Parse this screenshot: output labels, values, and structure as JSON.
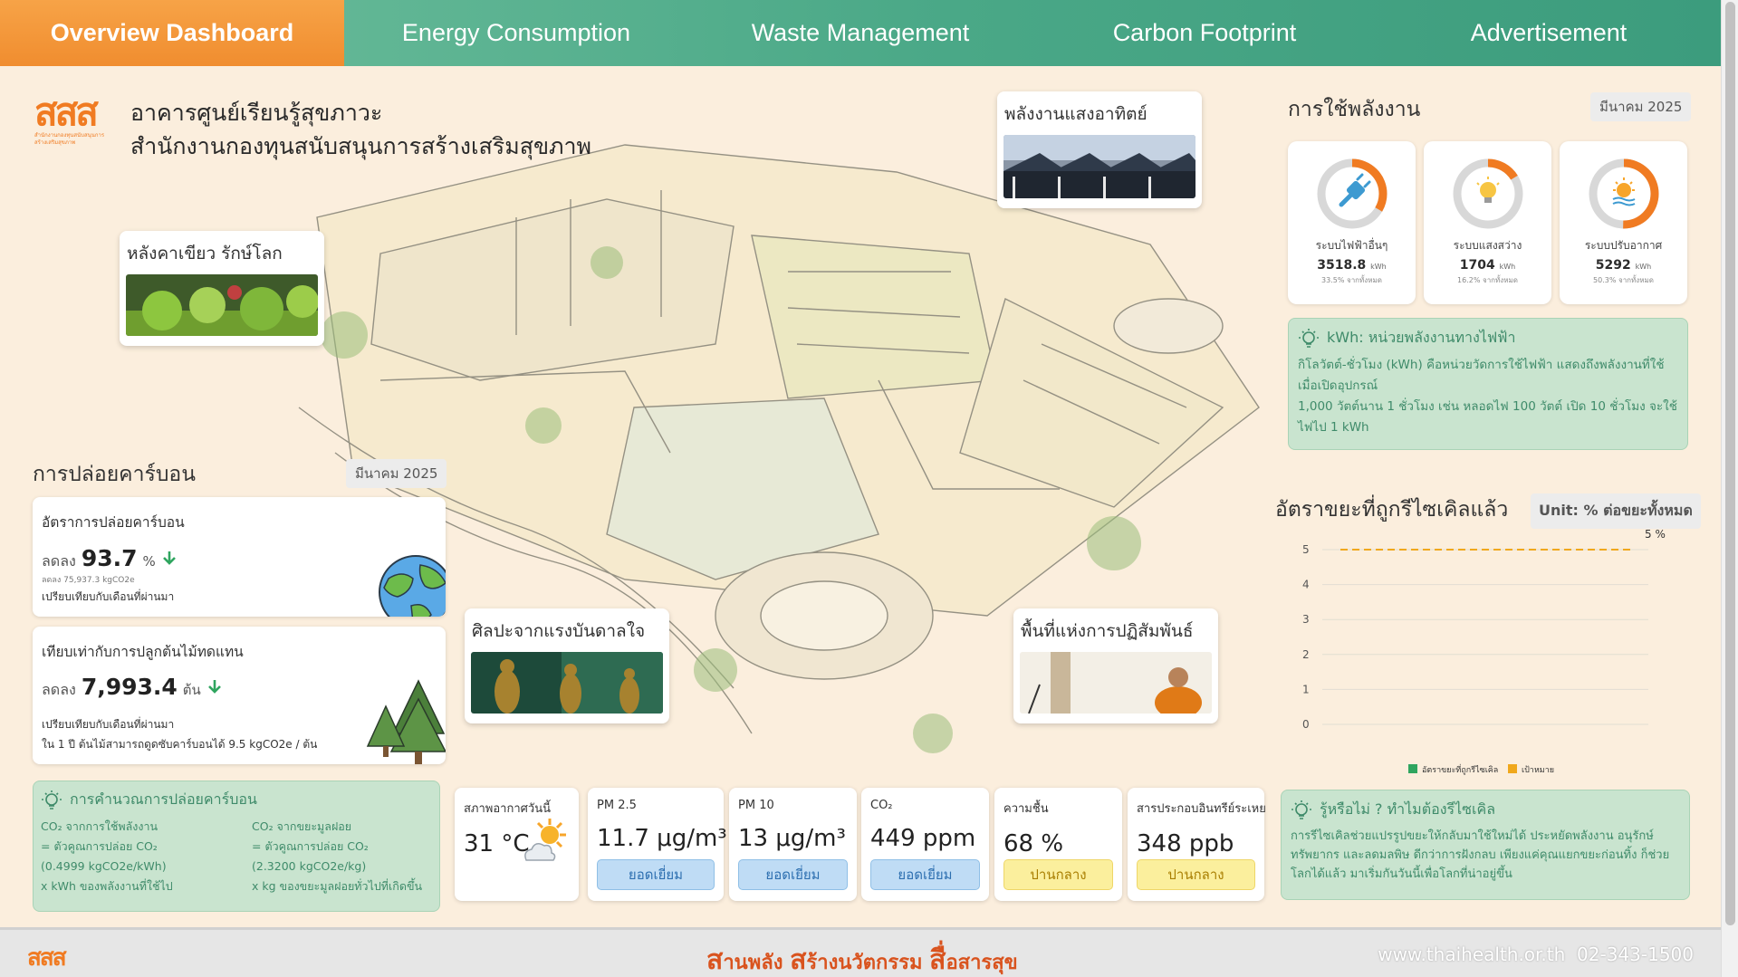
{
  "nav": {
    "tabs": [
      {
        "label": "Overview Dashboard",
        "active": true
      },
      {
        "label": "Energy Consumption",
        "active": false
      },
      {
        "label": "Waste Management",
        "active": false
      },
      {
        "label": "Carbon Footprint",
        "active": false
      },
      {
        "label": "Advertisement",
        "active": false
      }
    ]
  },
  "header": {
    "logo_text": "สสส",
    "logo_caption": "สำนักงานกองทุนสนับสนุนการสร้างเสริมสุขภาพ",
    "title_line1": "อาคารศูนย์เรียนรู้สุขภาวะ",
    "title_line2": "สำนักงานกองทุนสนับสนุนการสร้างเสริมสุขภาพ"
  },
  "photo_cards": {
    "green_roof": "หลังคาเขียว รักษ์โลก",
    "solar": "พลังงานแสงอาทิตย์",
    "art": "ศิลปะจากแรงบันดาลใจ",
    "interaction": "พื้นที่แห่งการปฏิสัมพันธ์"
  },
  "energy": {
    "title": "การใช้พลังงาน",
    "period": "มีนาคม 2025",
    "gauges": [
      {
        "label": "ระบบไฟฟ้าอื่นๆ",
        "value": "3518.8",
        "unit": "kWh",
        "share": "33.5% จากทั้งหมด",
        "fraction": 0.335,
        "icon": "plug-icon"
      },
      {
        "label": "ระบบแสงสว่าง",
        "value": "1704",
        "unit": "kWh",
        "share": "16.2% จากทั้งหมด",
        "fraction": 0.162,
        "icon": "bulb-icon"
      },
      {
        "label": "ระบบปรับอากาศ",
        "value": "5292",
        "unit": "kWh",
        "share": "50.3% จากทั้งหมด",
        "fraction": 0.503,
        "icon": "ac-icon"
      }
    ],
    "info_title": "kWh: หน่วยพลังงานทางไฟฟ้า",
    "info_line1": "กิโลวัตต์-ชั่วโมง (kWh) คือหน่วยวัดการใช้ไฟฟ้า แสดงถึงพลังงานที่ใช้เมื่อเปิดอุปกรณ์",
    "info_line2": "1,000 วัตต์นาน 1 ชั่วโมง เช่น หลอดไฟ 100 วัตต์ เปิด 10 ชั่วโมง จะใช้ไฟไป 1 kWh"
  },
  "carbon": {
    "title": "การปล่อยคาร์บอน",
    "period": "มีนาคม 2025",
    "rate_title": "อัตราการปล่อยคาร์บอน",
    "rate_prefix": "ลดลง",
    "rate_value": "93.7",
    "rate_unit": "%",
    "rate_detail": "ลดลง 75,937.3 kgCO2e",
    "rate_compare": "เปรียบเทียบกับเดือนที่ผ่านมา",
    "tree_title": "เทียบเท่ากับการปลูกต้นไม้ทดแทน",
    "tree_prefix": "ลดลง",
    "tree_value": "7,993.4",
    "tree_unit": "ต้น",
    "tree_compare": "เปรียบเทียบกับเดือนที่ผ่านมา",
    "tree_note": "ใน 1 ปี ต้นไม้สามารถดูดซับคาร์บอนได้ 9.5 kgCO2e / ต้น",
    "calc_title": "การคำนวณการปล่อยคาร์บอน",
    "calc_left": [
      "CO₂ จากการใช้พลังงาน",
      "= ตัวคูณการปล่อย CO₂",
      "(0.4999 kgCO2e/kWh)",
      "x kWh ของพลังงานที่ใช้ไป"
    ],
    "calc_right": [
      "CO₂ จากขยะมูลฝอย",
      "= ตัวคูณการปล่อย CO₂",
      "(2.3200 kgCO2e/kg)",
      "x kg ของขยะมูลฝอยทั่วไปที่เกิดขึ้น"
    ]
  },
  "recycle": {
    "title": "อัตราขยะที่ถูกรีไซเคิลแล้ว",
    "unit_chip": "Unit: % ต่อขยะทั้งหมด",
    "info_title": "รู้หรือไม่ ? ทำไมต้องรีไซเคิล",
    "info_text": "การรีไซเคิลช่วยแปรรูปขยะให้กลับมาใช้ใหม่ได้ ประหยัดพลังงาน อนุรักษ์ทรัพยากร และลดมลพิษ ดีกว่าการฝังกลบ เพียงแค่คุณแยกขยะก่อนทิ้ง ก็ช่วยโลกได้แล้ว มาเริ่มกันวันนี้เพื่อโลกที่น่าอยู่ขึ้น"
  },
  "chart_data": {
    "type": "line",
    "title": "อัตราขยะที่ถูกรีไซเคิลแล้ว",
    "ylim": [
      0,
      5
    ],
    "yticks": [
      "5",
      "4",
      "3",
      "2",
      "1",
      "0"
    ],
    "series": [
      {
        "name": "อัตราขยะที่ถูกรีไซเคิล",
        "values": [],
        "color": "#2fa55f"
      },
      {
        "name": "เป้าหมาย",
        "values": [
          5
        ],
        "color": "#f0a81c",
        "label": "5 %"
      }
    ],
    "legend": "bottom",
    "grid": true
  },
  "air": {
    "weather_label": "สภาพอากาศวันนี้",
    "weather_value": "31 °C",
    "cards": [
      {
        "label": "PM 2.5",
        "value": "11.7 μg/m³",
        "status": "ยอดเยี่ยม",
        "level": "good"
      },
      {
        "label": "PM 10",
        "value": "13 μg/m³",
        "status": "ยอดเยี่ยม",
        "level": "good"
      },
      {
        "label": "CO₂",
        "value": "449 ppm",
        "status": "ยอดเยี่ยม",
        "level": "good"
      },
      {
        "label": "ความชื้น",
        "value": "68 %",
        "status": "ปานกลาง",
        "level": "mid"
      },
      {
        "label": "สารประกอบอินทรีย์ระเหย",
        "value": "348 ppb",
        "status": "ปานกลาง",
        "level": "mid"
      }
    ]
  },
  "footer": {
    "logo_text": "สสส",
    "slogan_parts": [
      "ส",
      "านพลัง ",
      "ส",
      "ร้างนวัตกรรม ",
      "สื่",
      "อสารสุข"
    ],
    "website": "www.thaihealth.or.th",
    "phone": "02-343-1500"
  },
  "colors": {
    "accent": "#f08d2f",
    "nav": "#4aa887",
    "info_bg": "#c9e4cf",
    "gauge": "#f07b22"
  }
}
